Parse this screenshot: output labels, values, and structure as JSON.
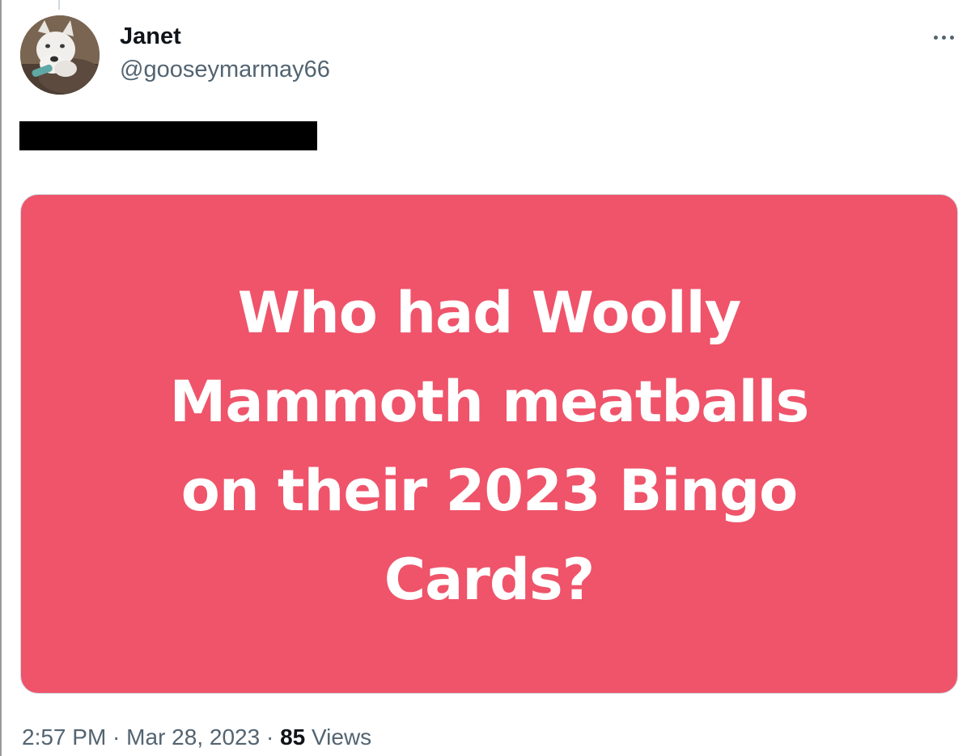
{
  "tweet": {
    "author": {
      "display_name": "Janet",
      "handle": "@gooseymarmay66",
      "avatar_icon": "husky-dog-avatar"
    },
    "more_icon": "more-horizontal-icon",
    "media": {
      "background_color": "#ef546a",
      "text_color": "#ffffff",
      "lines": [
        "Who had Woolly",
        "Mammoth meatballs",
        "on their 2023 Bingo",
        "Cards?"
      ]
    },
    "meta": {
      "time": "2:57 PM",
      "separator": " · ",
      "date": "Mar 28, 2023",
      "views_count": "85",
      "views_label": " Views"
    }
  }
}
